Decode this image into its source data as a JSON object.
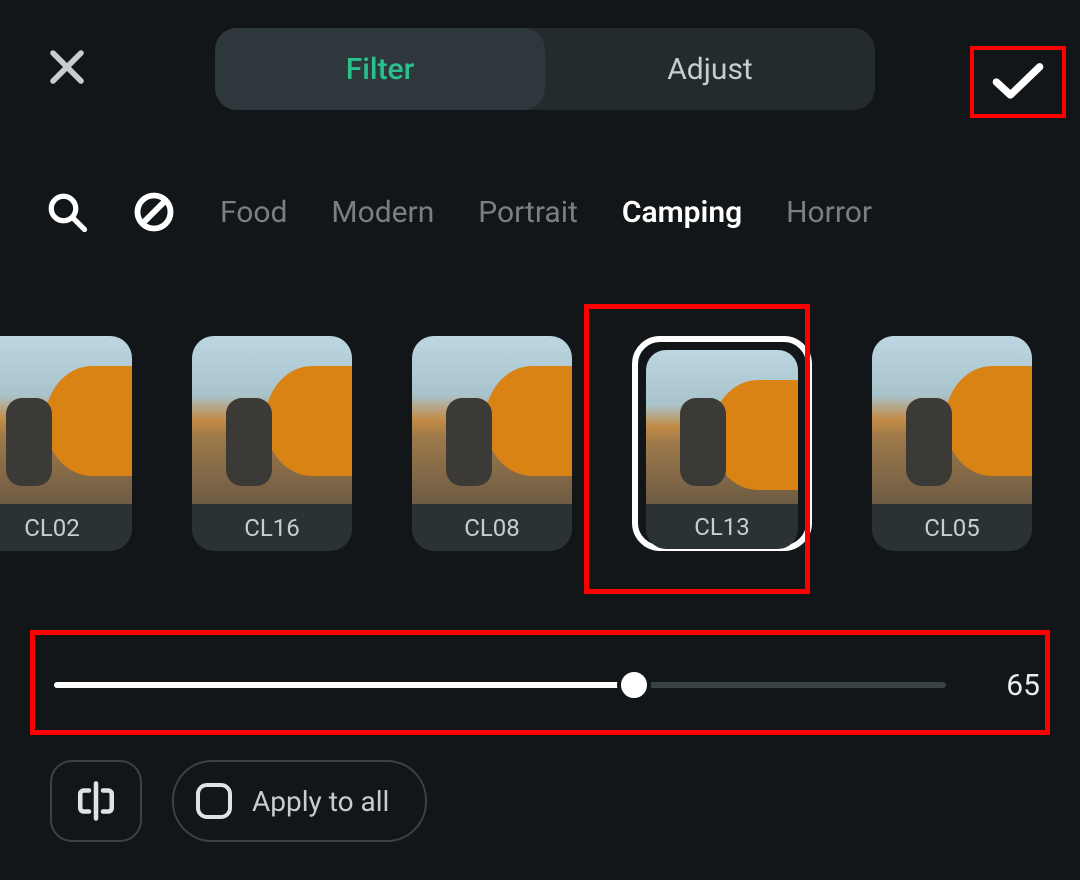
{
  "accent": "#29c08b",
  "header": {
    "segmented": {
      "filter": "Filter",
      "adjust": "Adjust",
      "active": "filter"
    }
  },
  "categories": {
    "items": [
      "Food",
      "Modern",
      "Portrait",
      "Camping",
      "Horror"
    ],
    "active_index": 3
  },
  "filters": {
    "items": [
      {
        "label": "CL02"
      },
      {
        "label": "CL16"
      },
      {
        "label": "CL08"
      },
      {
        "label": "CL13",
        "selected": true
      },
      {
        "label": "CL05"
      },
      {
        "label": ""
      }
    ],
    "selected_index": 3
  },
  "slider": {
    "value": 65,
    "min": 0,
    "max": 100
  },
  "bottom": {
    "apply_all_label": "Apply to all"
  }
}
